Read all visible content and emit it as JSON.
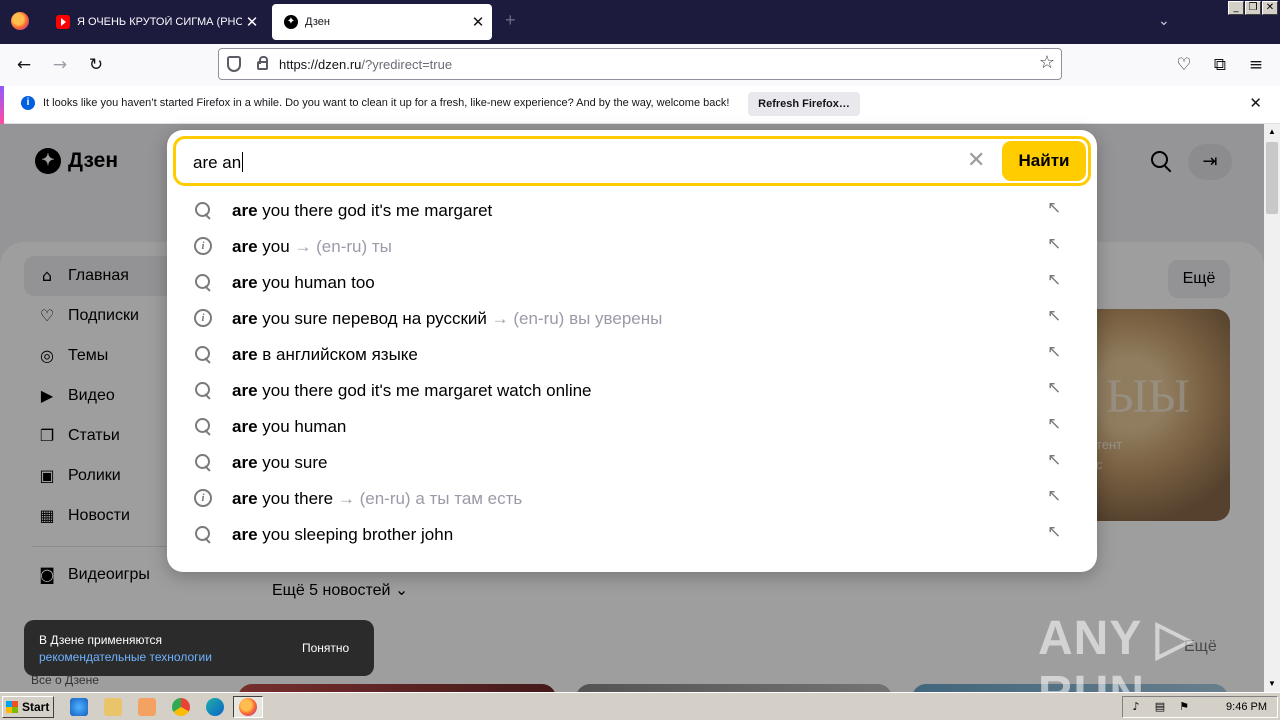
{
  "browser": {
    "tabs": [
      {
        "title": "Я ОЧЕНЬ КРУТОЙ СИГМА (PHONK",
        "close": "✕"
      },
      {
        "title": "Дзен",
        "close": "✕"
      }
    ],
    "new_tab": "+",
    "window_controls": [
      "_",
      "❐",
      "✕"
    ],
    "url_host": "https://dzen.ru",
    "url_rest": "/?yredirect=true",
    "notification": {
      "message": "It looks like you haven’t started Firefox in a while. Do you want to clean it up for a fresh, like-new experience? And by the way, welcome back!",
      "button": "Refresh Firefox…",
      "close": "✕"
    }
  },
  "page": {
    "logo": "Дзен",
    "nav": [
      {
        "label": "Главная",
        "icon": "⌂"
      },
      {
        "label": "Подписки",
        "icon": "♡"
      },
      {
        "label": "Темы",
        "icon": "◎"
      },
      {
        "label": "Видео",
        "icon": "▶"
      },
      {
        "label": "Статьи",
        "icon": "❐"
      },
      {
        "label": "Ролики",
        "icon": "▣"
      },
      {
        "label": "Новости",
        "icon": "▦"
      },
      {
        "label": "Видеоигры",
        "icon": "◙"
      }
    ],
    "more_button": "Ещё",
    "more_news": "Ещё 5 новостей",
    "card_big": "ЫЫ",
    "card_line1": "тент",
    "card_line2": "с",
    "bottom_more": "Ещё",
    "footer_link": "Все о Дзене"
  },
  "search": {
    "query": "are an",
    "submit": "Найти",
    "clear": "✕",
    "suggestions": [
      {
        "type": "search",
        "bold": "are",
        "rest": " you there god it's me margaret",
        "translation": ""
      },
      {
        "type": "info",
        "bold": "are",
        "rest": " you",
        "translation": " → (en-ru) ты"
      },
      {
        "type": "search",
        "bold": "are",
        "rest": " you human too",
        "translation": ""
      },
      {
        "type": "info",
        "bold": "are",
        "rest": " you sure перевод на русский",
        "translation": " → (en-ru) вы уверены"
      },
      {
        "type": "search",
        "bold": "are",
        "rest": " в английском языке",
        "translation": ""
      },
      {
        "type": "search",
        "bold": "are",
        "rest": " you there god it's me margaret watch online",
        "translation": ""
      },
      {
        "type": "search",
        "bold": "are",
        "rest": " you human",
        "translation": ""
      },
      {
        "type": "search",
        "bold": "are",
        "rest": " you sure",
        "translation": ""
      },
      {
        "type": "info",
        "bold": "are",
        "rest": " you there",
        "translation": " → (en-ru) а ты там есть"
      },
      {
        "type": "search",
        "bold": "are",
        "rest": " you sleeping brother john",
        "translation": ""
      }
    ],
    "fill_icon": "↖"
  },
  "toast": {
    "line1": "В Дзене применяются",
    "line2": "рекомендательные технологии",
    "ok": "Понятно"
  },
  "watermark": "ANY ▷ RUN",
  "taskbar": {
    "start": "Start",
    "time": "9:46 PM"
  },
  "colors": {
    "accent_yellow": "#ffcc00",
    "tabstrip": "#1c1b3e",
    "toast_link": "#6fb3ff"
  }
}
